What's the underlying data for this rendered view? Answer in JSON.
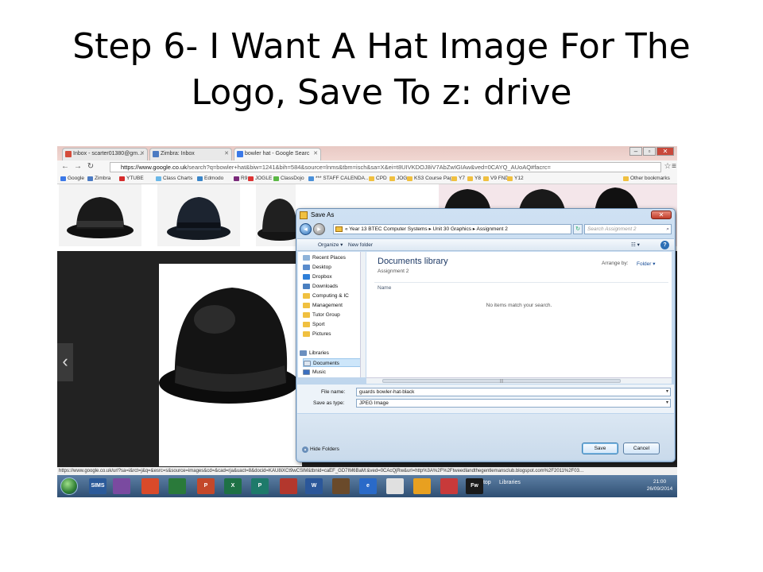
{
  "slide": {
    "title_line1": "Step 6- I Want A Hat Image For The",
    "title_line2": "Logo, Save To z: drive"
  },
  "browser": {
    "tabs": [
      {
        "label": "Inbox - scarter01380@gm…",
        "icon": "gmail-icon",
        "color": "#d44b3a"
      },
      {
        "label": "Zimbra: Inbox",
        "icon": "zimbra-icon",
        "color": "#4c7bc2"
      },
      {
        "label": "bowler hat - Google Searc",
        "icon": "google-icon",
        "color": "#3b78e7"
      }
    ],
    "url_host": "https://www.google.co.uk",
    "url_rest": "/search?q=bowler+hat&biw=1241&bih=584&source=lnms&tbm=isch&sa=X&ei=t8UIVKDOJ8iV7AbZwIGIAw&ved=0CAYQ_AUoAQ#facrc=",
    "bookmarks": [
      {
        "label": "Google",
        "color": "#3b78e7"
      },
      {
        "label": "Zimbra",
        "color": "#4c7bc2"
      },
      {
        "label": "YTUBE",
        "color": "#d62b2b"
      },
      {
        "label": "Class Charts",
        "color": "#6bb8e8"
      },
      {
        "label": "Edmodo",
        "color": "#3a85c8"
      },
      {
        "label": "R9",
        "color": "#7a2a7a"
      },
      {
        "label": "JOGLE",
        "color": "#d33"
      },
      {
        "label": "ClassDojo",
        "color": "#5bb845"
      },
      {
        "label": "*** STAFF CALENDA…",
        "color": "#4a90d9"
      },
      {
        "label": "CPD",
        "color": "#f0c040"
      },
      {
        "label": "JOG",
        "color": "#f0c040"
      },
      {
        "label": "KS3 Course Page",
        "color": "#f0c040"
      },
      {
        "label": "Y7",
        "color": "#f0c040"
      },
      {
        "label": "Y8",
        "color": "#f0c040"
      },
      {
        "label": "V9 FND",
        "color": "#f0c040"
      },
      {
        "label": "Y12",
        "color": "#f0c040"
      },
      {
        "label": "Other bookmarks",
        "color": "#f0c040"
      }
    ],
    "status_url": "https://www.google.co.uk/url?sa=i&rct=j&q=&esrc=s&source=images&cd=&cad=rja&uact=8&docid=KAU8iXCt9wCSlM&tbnid=caEF_GD7IM6BaM:&ved=0CAcQjRw&url=http%3A%2F%2Ftweedlandthegentlemansclub.blogspot.com%2F2011%2F03…"
  },
  "dialog": {
    "title": "Save As",
    "path": "« Year 13 BTEC Computer Systems  ▸  Unit 30 Graphics  ▸  Assignment 2",
    "search_placeholder": "Search Assignment 2",
    "organize_label": "Organize ▾",
    "new_folder_label": "New folder",
    "nav_items": [
      {
        "label": "Recent Places",
        "color": "#8fb3d9"
      },
      {
        "label": "Desktop",
        "color": "#5a8ccc"
      },
      {
        "label": "Dropbox",
        "color": "#2e7fd8"
      },
      {
        "label": "Downloads",
        "color": "#4a7fc0"
      },
      {
        "label": "Computing & IC",
        "color": "#f0c040"
      },
      {
        "label": "Management",
        "color": "#f0c040"
      },
      {
        "label": "Tutor Group",
        "color": "#f0c040"
      },
      {
        "label": "Sport",
        "color": "#f0c040"
      },
      {
        "label": "Pictures",
        "color": "#f0c040"
      }
    ],
    "libraries_label": "Libraries",
    "lib_items": [
      {
        "label": "Documents",
        "color": "#dde6f0"
      },
      {
        "label": "Music",
        "color": "#3a6fc0"
      }
    ],
    "library_title": "Documents library",
    "library_subtitle": "Assignment 2",
    "arrange_label": "Arrange by:",
    "arrange_value": "Folder ▾",
    "column_name": "Name",
    "empty_message": "No items match your search.",
    "file_name_label": "File name:",
    "file_name_value": "guards bowler-hat-black",
    "save_type_label": "Save as type:",
    "save_type_value": "JPEG Image",
    "hide_folders_label": "Hide Folders",
    "save_button": "Save",
    "cancel_button": "Cancel"
  },
  "taskbar": {
    "apps": [
      {
        "label": "SIMS",
        "color": "#2b5a9a"
      },
      {
        "label": "",
        "color": "#7a4aa0"
      },
      {
        "label": "",
        "color": "#d94a2a"
      },
      {
        "label": "",
        "color": "#2a7a3a"
      },
      {
        "label": "P",
        "color": "#c4482a"
      },
      {
        "label": "X",
        "color": "#1e7145"
      },
      {
        "label": "P",
        "color": "#1e7a6a"
      },
      {
        "label": "",
        "color": "#b3372d"
      },
      {
        "label": "W",
        "color": "#2b579a"
      },
      {
        "label": "",
        "color": "#6a4a2a"
      },
      {
        "label": "e",
        "color": "#2a6ac8"
      },
      {
        "label": "",
        "color": "#e0e0e0"
      },
      {
        "label": "",
        "color": "#e8a020"
      },
      {
        "label": "",
        "color": "#c83a3a"
      },
      {
        "label": "Fw",
        "color": "#1a1a1a"
      }
    ],
    "desktop_label": "Desktop",
    "libraries_label": "Libraries",
    "time": "21:00",
    "date": "26/09/2014"
  }
}
